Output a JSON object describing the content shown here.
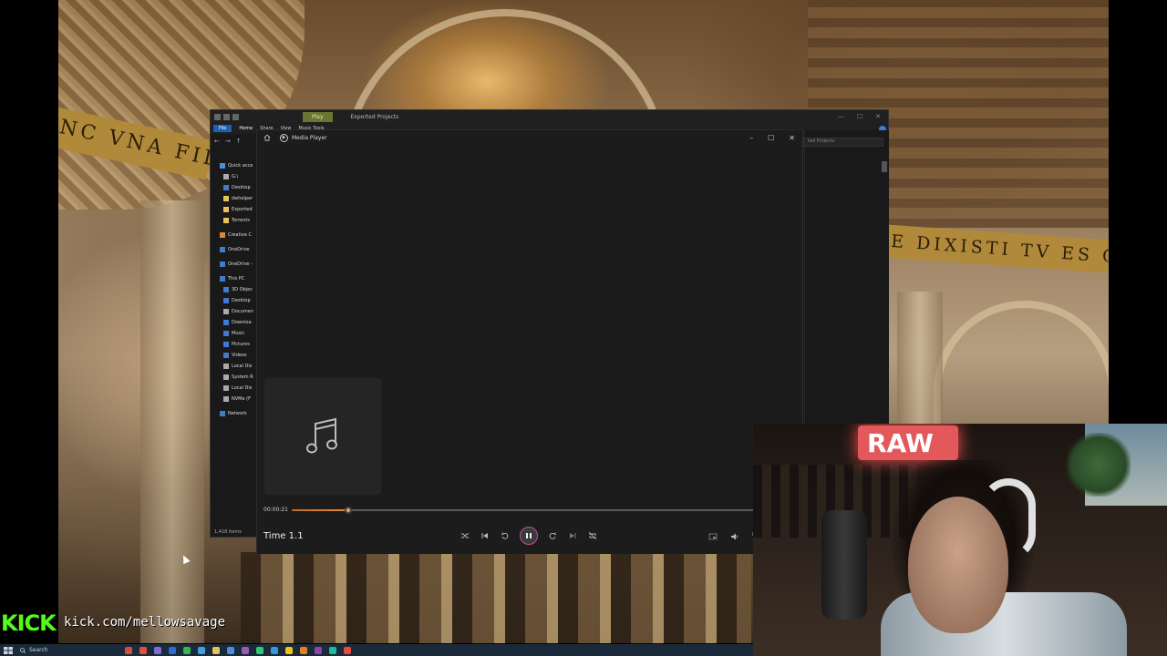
{
  "wallpaper": {
    "inscription_left": "NC VNA FID",
    "inscription_right": "E DIXISTI TV ES CHR"
  },
  "explorer": {
    "ribbon_tabs": [
      "File",
      "Home",
      "Share",
      "View",
      "Music Tools"
    ],
    "context_tab": "Play",
    "window_title": "Exported Projects",
    "search_placeholder": "ted Projects",
    "nav_items": [
      {
        "label": "Quick acce",
        "icon": "star-icon",
        "color": "#4b8fe0"
      },
      {
        "label": "G:\\",
        "icon": "drive-icon",
        "color": "#aaaaaa"
      },
      {
        "label": "Desktop",
        "icon": "desktop-icon",
        "color": "#3f7bd0"
      },
      {
        "label": "dwhelper",
        "icon": "folder-icon",
        "color": "#e7c15a"
      },
      {
        "label": "Exported",
        "icon": "folder-icon",
        "color": "#e7c15a"
      },
      {
        "label": "Torrents",
        "icon": "folder-icon",
        "color": "#e7c15a"
      },
      {
        "label": "Creative C",
        "icon": "folder-icon",
        "color": "#d98a3c"
      },
      {
        "label": "OneDrive",
        "icon": "cloud-icon",
        "color": "#3f7bd0"
      },
      {
        "label": "OneDrive -",
        "icon": "cloud-icon",
        "color": "#3f7bd0"
      },
      {
        "label": "This PC",
        "icon": "pc-icon",
        "color": "#3f7bd0"
      },
      {
        "label": "3D Objec",
        "icon": "cube-icon",
        "color": "#3f7bd0"
      },
      {
        "label": "Desktop",
        "icon": "desktop-icon",
        "color": "#3f7bd0"
      },
      {
        "label": "Documen",
        "icon": "document-icon",
        "color": "#aaaaaa"
      },
      {
        "label": "Downloa",
        "icon": "download-icon",
        "color": "#3f7bd0"
      },
      {
        "label": "Music",
        "icon": "music-icon",
        "color": "#3f7bd0"
      },
      {
        "label": "Pictures",
        "icon": "pictures-icon",
        "color": "#3f7bd0"
      },
      {
        "label": "Videos",
        "icon": "videos-icon",
        "color": "#3f7bd0"
      },
      {
        "label": "Local Dis",
        "icon": "drive-icon",
        "color": "#aaaaaa"
      },
      {
        "label": "System R",
        "icon": "drive-icon",
        "color": "#aaaaaa"
      },
      {
        "label": "Local Dis",
        "icon": "drive-icon",
        "color": "#aaaaaa"
      },
      {
        "label": "NVMe (F",
        "icon": "drive-icon",
        "color": "#aaaaaa"
      },
      {
        "label": "Network",
        "icon": "network-icon",
        "color": "#3f7bd0"
      }
    ],
    "status": "1,418 items"
  },
  "media_player": {
    "title": "Media Player",
    "elapsed": "00:00:21",
    "progress_fraction": 0.11,
    "track_title": "Time 1.1",
    "accent_color": "#e0893a",
    "play_ring_color": "#c04e9a"
  },
  "overlay": {
    "kick_logo": "KICK",
    "kick_url": "kick.com/mellowsavage",
    "neon_sign": "RAW"
  },
  "taskbar": {
    "search_label": "Search"
  }
}
